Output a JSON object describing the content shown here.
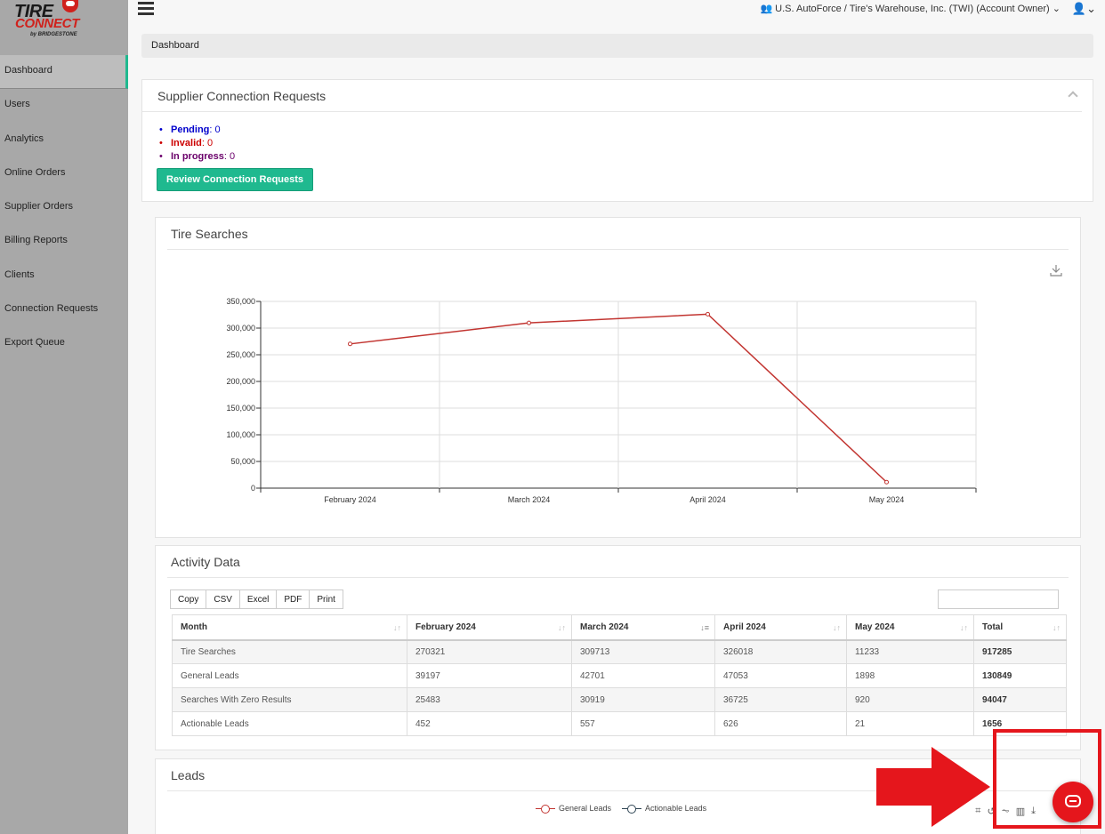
{
  "brand": {
    "line1": "TIRE",
    "line2": "CONNECT",
    "line3": "by BRIDGESTONE"
  },
  "sidebar": {
    "items": [
      {
        "label": "Dashboard",
        "active": true
      },
      {
        "label": "Users"
      },
      {
        "label": "Analytics"
      },
      {
        "label": "Online Orders"
      },
      {
        "label": "Supplier Orders"
      },
      {
        "label": "Billing Reports"
      },
      {
        "label": "Clients"
      },
      {
        "label": "Connection Requests"
      },
      {
        "label": "Export Queue"
      }
    ]
  },
  "topbar": {
    "account": "U.S. AutoForce / Tire's Warehouse, Inc. (TWI) (Account Owner)"
  },
  "breadcrumb": "Dashboard",
  "supplier": {
    "title": "Supplier Connection Requests",
    "pending_label": "Pending",
    "pending_value": ": 0",
    "invalid_label": "Invalid",
    "invalid_value": ": 0",
    "progress_label": "In progress",
    "progress_value": ": 0",
    "button": "Review Connection Requests"
  },
  "tire_searches": {
    "title": "Tire Searches"
  },
  "chart_data": {
    "type": "line",
    "categories": [
      "February 2024",
      "March 2024",
      "April 2024",
      "May 2024"
    ],
    "series": [
      {
        "values": [
          270321,
          309713,
          326018,
          11233
        ]
      }
    ],
    "yticks": [
      "0",
      "50,000",
      "100,000",
      "150,000",
      "200,000",
      "250,000",
      "300,000",
      "350,000"
    ],
    "ylim": [
      0,
      350000
    ],
    "grid": true,
    "color": "#c23531"
  },
  "activity": {
    "title": "Activity Data",
    "buttons": [
      "Copy",
      "CSV",
      "Excel",
      "PDF",
      "Print"
    ],
    "headers": [
      "Month",
      "February 2024",
      "March 2024",
      "April 2024",
      "May 2024",
      "Total"
    ],
    "rows": [
      [
        "Tire Searches",
        "270321",
        "309713",
        "326018",
        "11233",
        "917285"
      ],
      [
        "General Leads",
        "39197",
        "42701",
        "47053",
        "1898",
        "130849"
      ],
      [
        "Searches With Zero Results",
        "25483",
        "30919",
        "36725",
        "920",
        "94047"
      ],
      [
        "Actionable Leads",
        "452",
        "557",
        "626",
        "21",
        "1656"
      ]
    ]
  },
  "leads": {
    "title": "Leads",
    "legend": [
      "General Leads",
      "Actionable Leads"
    ]
  },
  "colors": {
    "accent": "#1fb98f",
    "annotation": "#e5161c"
  }
}
